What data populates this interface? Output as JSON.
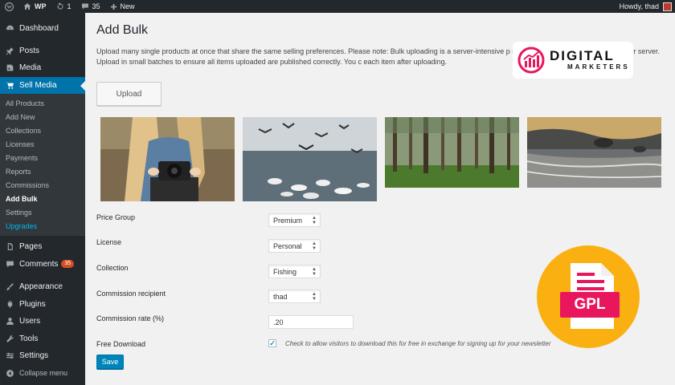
{
  "adminbar": {
    "site_name": "WP",
    "updates_count": "1",
    "comments_count": "35",
    "new_label": "New",
    "howdy": "Howdy, thad"
  },
  "sidebar": {
    "items": [
      {
        "label": "Dashboard",
        "icon": "dashboard-icon"
      },
      {
        "label": "Posts",
        "icon": "pin-icon"
      },
      {
        "label": "Media",
        "icon": "media-icon"
      },
      {
        "label": "Sell Media",
        "icon": "cart-icon"
      }
    ],
    "submenu": [
      "All Products",
      "Add New",
      "Collections",
      "Licenses",
      "Payments",
      "Reports",
      "Commissions",
      "Add Bulk",
      "Settings",
      "Upgrades"
    ],
    "items_after": [
      {
        "label": "Pages",
        "icon": "pages-icon"
      },
      {
        "label": "Comments",
        "icon": "comments-icon",
        "badge": "35"
      },
      {
        "label": "Appearance",
        "icon": "brush-icon"
      },
      {
        "label": "Plugins",
        "icon": "plugin-icon"
      },
      {
        "label": "Users",
        "icon": "users-icon"
      },
      {
        "label": "Tools",
        "icon": "wrench-icon"
      },
      {
        "label": "Settings",
        "icon": "settings-icon"
      },
      {
        "label": "Collapse menu",
        "icon": "collapse-icon"
      }
    ]
  },
  "main": {
    "title": "Add Bulk",
    "description": "Upload many single products at once that share the same selling preferences. Please note: Bulk uploading is a server-intensive p                                                      s dependent on the capabilities of your server. Upload in small batches to ensure all items uploaded are published correctly. You c                                                      each item after uploading.",
    "upload_label": "Upload",
    "fields": {
      "price_group": {
        "label": "Price Group",
        "value": "Premium"
      },
      "license": {
        "label": "License",
        "value": "Personal"
      },
      "collection": {
        "label": "Collection",
        "value": "Fishing"
      },
      "commission_recipient": {
        "label": "Commission recipient",
        "value": "thad"
      },
      "commission_rate": {
        "label": "Commission rate (%)",
        "value": ".20"
      },
      "free_download": {
        "label": "Free Download",
        "checked": true,
        "description": "Check to allow visitors to download this for free in exchange for signing up for your newsletter"
      }
    },
    "save_label": "Save"
  },
  "overlays": {
    "logo_line1": "DIGITAL",
    "logo_line2": "MARKETERS",
    "gpl": "GPL"
  },
  "colors": {
    "sidebar_bg": "#23282d",
    "accent": "#0073aa",
    "save_button": "#0085ba",
    "badge": "#d54e21",
    "gpl_circle": "#fbb012",
    "gpl_label": "#e8175d"
  }
}
